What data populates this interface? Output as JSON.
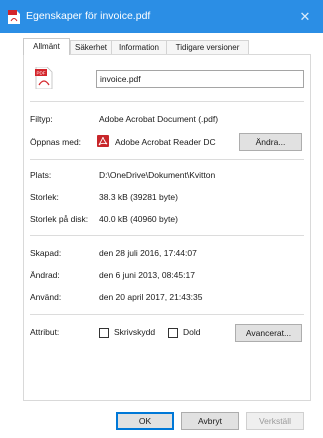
{
  "window": {
    "title": "Egenskaper för invoice.pdf",
    "close_glyph": "✕",
    "accent_color": "#2b8ee5"
  },
  "tabs": [
    {
      "label": "Allmänt",
      "active": true
    },
    {
      "label": "Säkerhet",
      "active": false
    },
    {
      "label": "Information",
      "active": false
    },
    {
      "label": "Tidigare versioner",
      "active": false
    }
  ],
  "general": {
    "file_icon_name": "pdf-file-icon",
    "filename": "invoice.pdf",
    "type_label": "Filtyp:",
    "type_value": "Adobe Acrobat Document (.pdf)",
    "opens_with_label": "Öppnas med:",
    "opens_with_app_icon": "acrobat-reader-icon",
    "opens_with_value": "Adobe Acrobat Reader DC",
    "change_button": "Ändra...",
    "location_label": "Plats:",
    "location_value": "D:\\OneDrive\\Dokument\\Kvitton",
    "size_label": "Storlek:",
    "size_value": "38.3 kB (39281 byte)",
    "size_on_disk_label": "Storlek på disk:",
    "size_on_disk_value": "40.0 kB (40960 byte)",
    "created_label": "Skapad:",
    "created_value": "den 28 juli 2016, 17:44:07",
    "modified_label": "Ändrad:",
    "modified_value": "den 6 juni 2013, 08:45:17",
    "accessed_label": "Använd:",
    "accessed_value": "den 20 april 2017, 21:43:35",
    "attributes_label": "Attribut:",
    "readonly_label": "Skrivskydd",
    "readonly_checked": false,
    "hidden_label": "Dold",
    "hidden_checked": false,
    "advanced_button": "Avancerat..."
  },
  "footer": {
    "ok": "OK",
    "cancel": "Avbryt",
    "apply": "Verkställ"
  }
}
